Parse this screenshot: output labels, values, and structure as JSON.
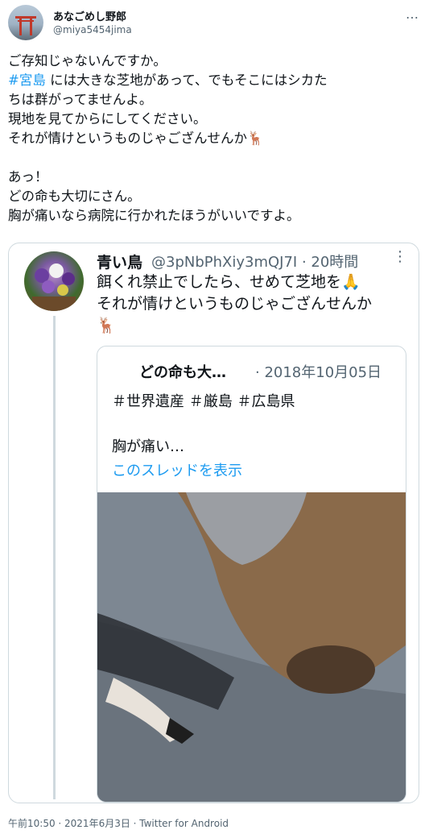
{
  "tweet": {
    "author_name": "あなごめし野郎",
    "author_handle": "@miya5454jima",
    "more_icon": "…",
    "text_line1": "ご存知じゃないんですか。",
    "hashtag": "#宮島",
    "text_after_hashtag": " には大きな芝地があって、でもそこにはシカた",
    "text_line3": "ちは群がってませんよ。",
    "text_line4": "現地を見てからにしてください。",
    "text_line5": "それが情けというものじゃござんせんか🦌",
    "text_line6": "",
    "text_line7": "あっ！",
    "text_line8": "どの命も大切にさん。",
    "text_line9": "胸が痛いなら病院に行かれたほうがいいですよ。",
    "footer": "午前10:50 · 2021年6月3日 · Twitter for Android"
  },
  "quoted": {
    "name": "青い鳥",
    "meta": "@3pNbPhXiy3mQJ7I · 20時間",
    "more_icon": "⋮",
    "text": "餌くれ禁止でしたら、せめて芝地を🙏\nそれが情けというものじゃござんせんか\n🦌",
    "inner": {
      "name": "どの命も大…",
      "date": "· 2018年10月05日",
      "tags": "＃世界遺産 ＃厳島 ＃広島県",
      "body": "胸が痛い…",
      "link": "このスレッドを表示"
    }
  },
  "colors": {
    "accent": "#1d9bf0",
    "secondary": "#536471",
    "border": "#cfd9de"
  }
}
